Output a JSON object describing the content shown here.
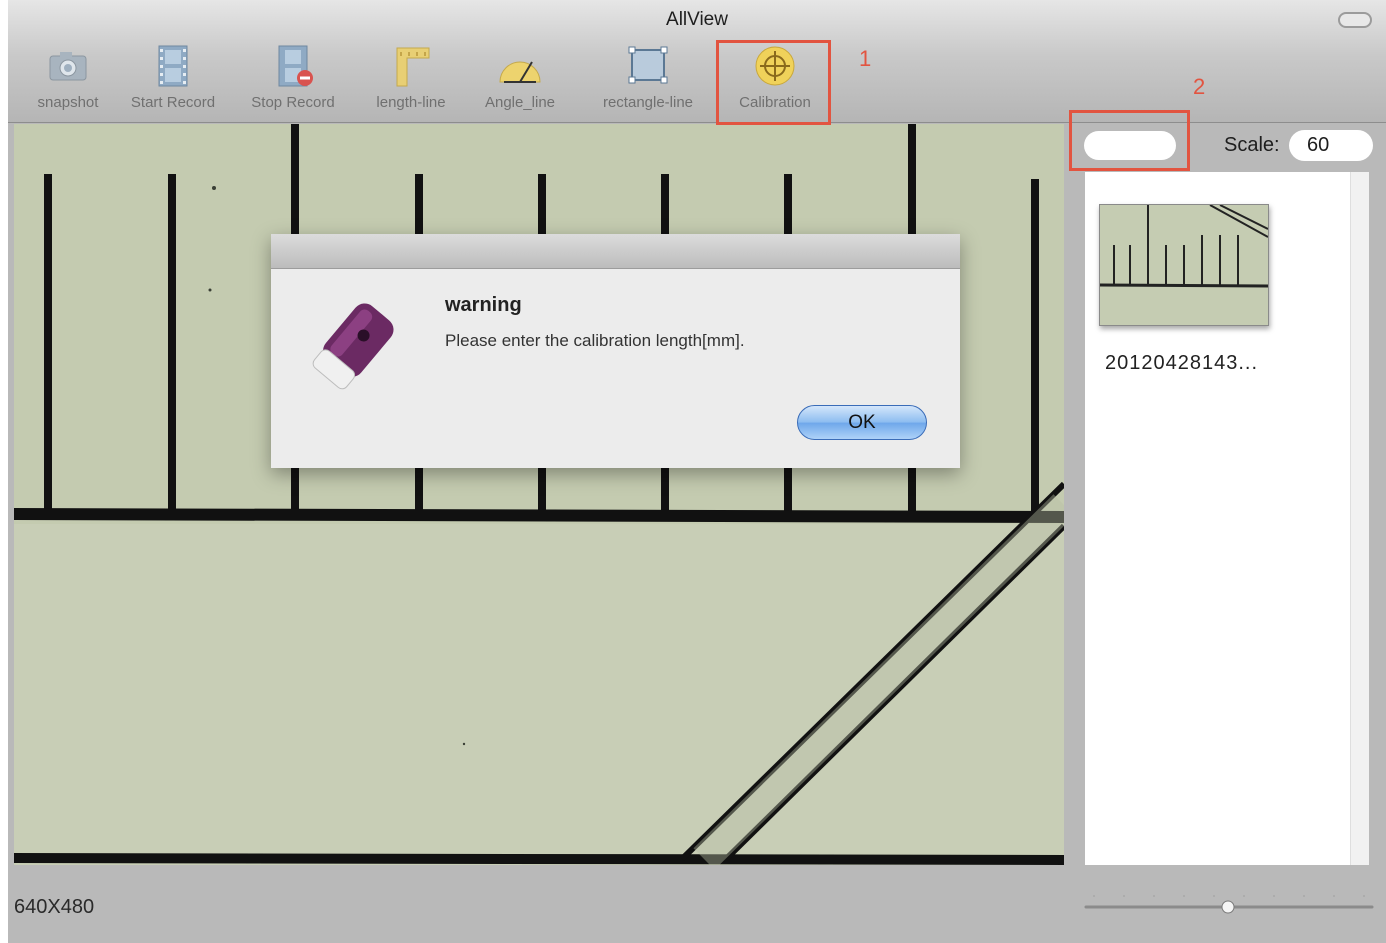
{
  "window": {
    "title": "AllView"
  },
  "toolbar": {
    "snapshot": "snapshot",
    "start_record": "Start Record",
    "stop_record": "Stop Record",
    "length_line": "length-line",
    "angle_line": "Angle_line",
    "rectangle_line": "rectangle-line",
    "calibration": "Calibration"
  },
  "annotations": {
    "marker_1": "1",
    "marker_2": "2",
    "color": "#e25440"
  },
  "panel": {
    "name_value": "",
    "scale_label": "Scale:",
    "scale_value": "60",
    "thumbnail_name": "20120428143..."
  },
  "status": {
    "resolution": "640X480"
  },
  "dialog": {
    "title": "warning",
    "message": "Please enter the calibration length[mm].",
    "ok": "OK"
  },
  "icons": [
    "camera-icon",
    "film-icon",
    "film-stop-icon",
    "length-line-icon",
    "angle-line-icon",
    "rectangle-line-icon",
    "calibration-crosshair-icon",
    "usb-microscope-icon"
  ]
}
